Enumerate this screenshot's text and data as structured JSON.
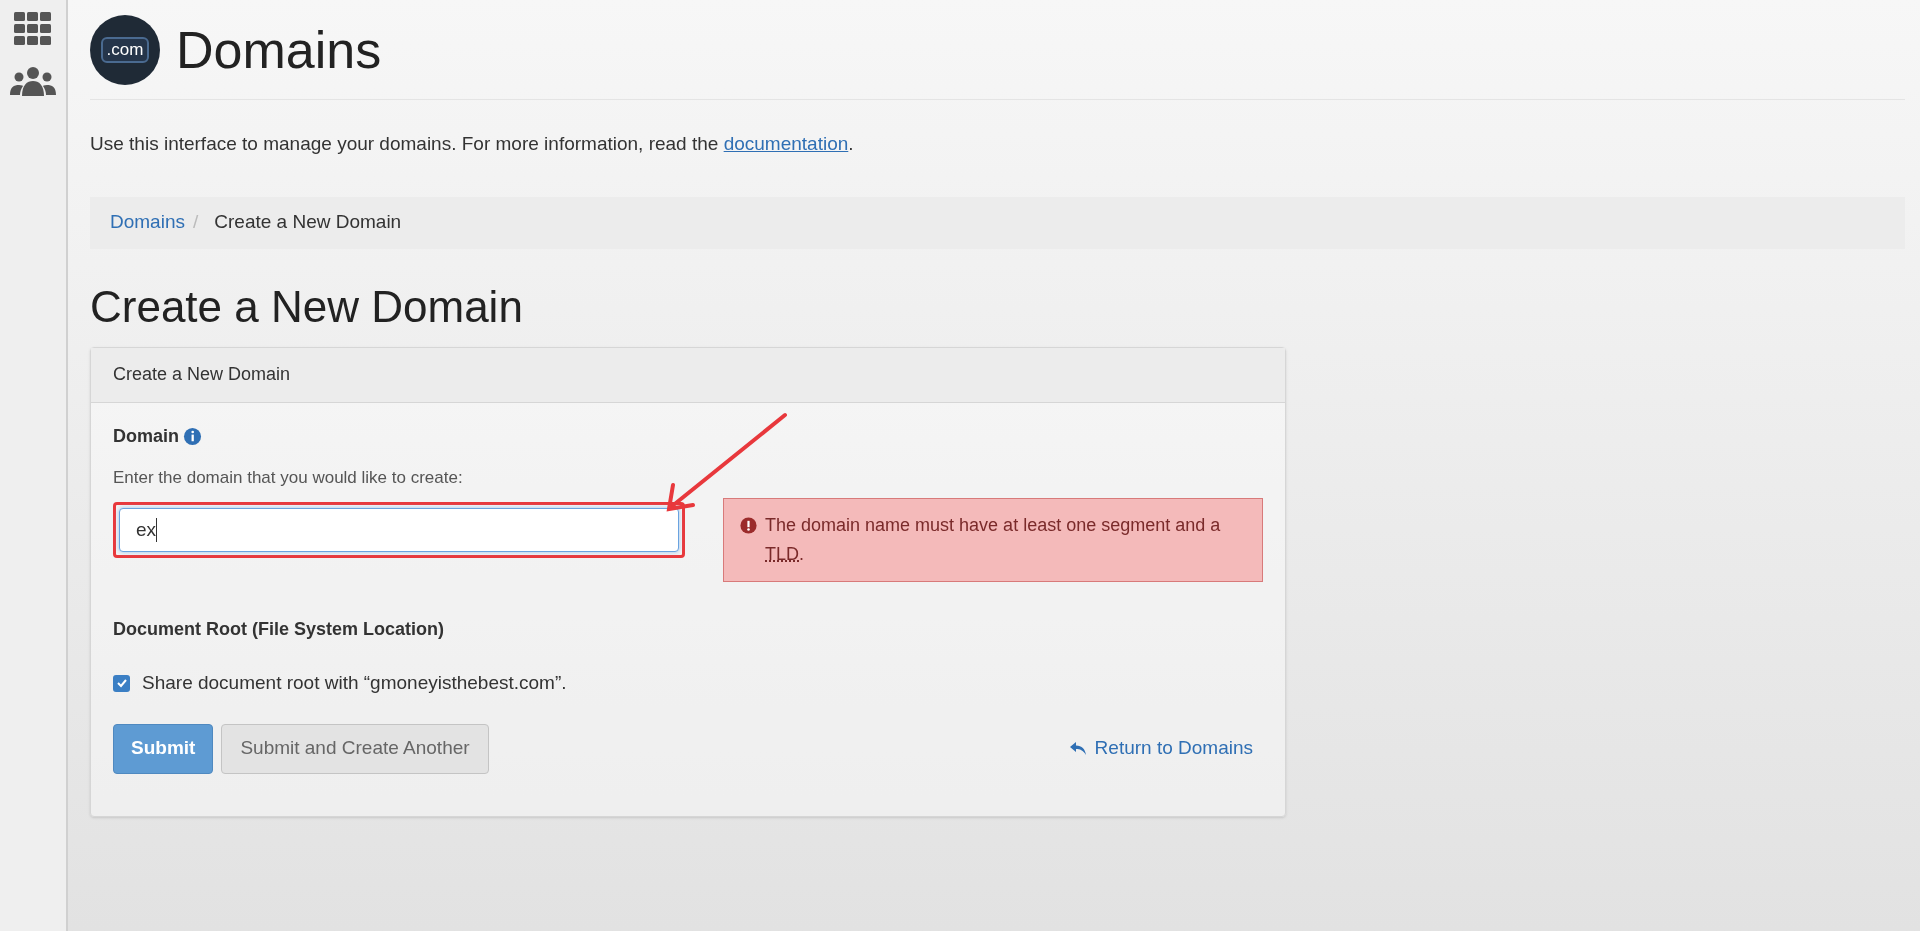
{
  "sidebar": {
    "items": [
      {
        "kind": "grid"
      },
      {
        "kind": "users"
      }
    ]
  },
  "header": {
    "logo_text": ".com",
    "title": "Domains"
  },
  "intro": {
    "text": "Use this interface to manage your domains. For more information, read the ",
    "link": "documentation",
    "end": "."
  },
  "breadcrumb_separator": "/",
  "breadcrumb": [
    {
      "label": "Domains",
      "link": true
    },
    {
      "label": "Create a New Domain",
      "link": false
    }
  ],
  "page_title": "Create a New Domain",
  "panel": {
    "heading": "Create a New Domain",
    "domain": {
      "label": "Domain",
      "help": "Enter the domain that you would like to create:",
      "value": "ex",
      "error": {
        "before": "The domain name must have at least one segment and a ",
        "abbr": "TLD",
        "after": "."
      }
    },
    "document_root": {
      "label": "Document Root (File System Location)",
      "checkbox": {
        "label": "Share document root with “gmoneyisthebest.com”.",
        "checked": true
      }
    },
    "buttons": [
      {
        "label": "Submit",
        "kind": "primary"
      },
      {
        "label": "Submit and Create Another",
        "kind": "default"
      }
    ],
    "return_link": "Return to Domains"
  }
}
